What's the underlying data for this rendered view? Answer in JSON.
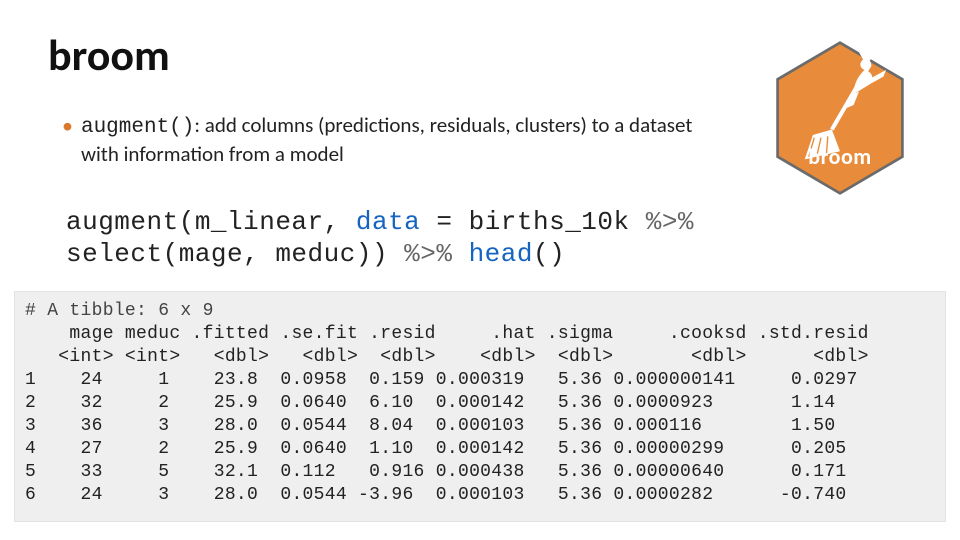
{
  "title": "broom",
  "hex": {
    "name": "broom",
    "sub": ""
  },
  "bullet": {
    "fn": "augment()",
    "text": ": add columns (predictions, residuals, clusters) to a dataset with information from a model"
  },
  "code": {
    "l1a": "augment(m_linear, ",
    "l1b": "data",
    "l1c": " = births_10k ",
    "l1d": "%>%",
    "l2a": "           select(mage, meduc)) ",
    "l2b": "%>% ",
    "l2c": "head",
    "l2d": "()"
  },
  "output": {
    "h0": "# A tibble: 6 x 9",
    "h1": "    mage meduc .fitted .se.fit .resid     .hat .sigma     .cooksd .std.resid",
    "h2": "   <int> <int>   <dbl>   <dbl>  <dbl>    <dbl>  <dbl>       <dbl>      <dbl>",
    "r1": "1    24     1    23.8  0.0958  0.159 0.000319   5.36 0.000000141     0.0297",
    "r2": "2    32     2    25.9  0.0640  6.10  0.000142   5.36 0.0000923       1.14  ",
    "r3": "3    36     3    28.0  0.0544  8.04  0.000103   5.36 0.000116        1.50  ",
    "r4": "4    27     2    25.9  0.0640  1.10  0.000142   5.36 0.00000299      0.205 ",
    "r5": "5    33     5    32.1  0.112   0.916 0.000438   5.36 0.00000640      0.171 ",
    "r6": "6    24     3    28.0  0.0544 -3.96  0.000103   5.36 0.0000282      -0.740 "
  }
}
